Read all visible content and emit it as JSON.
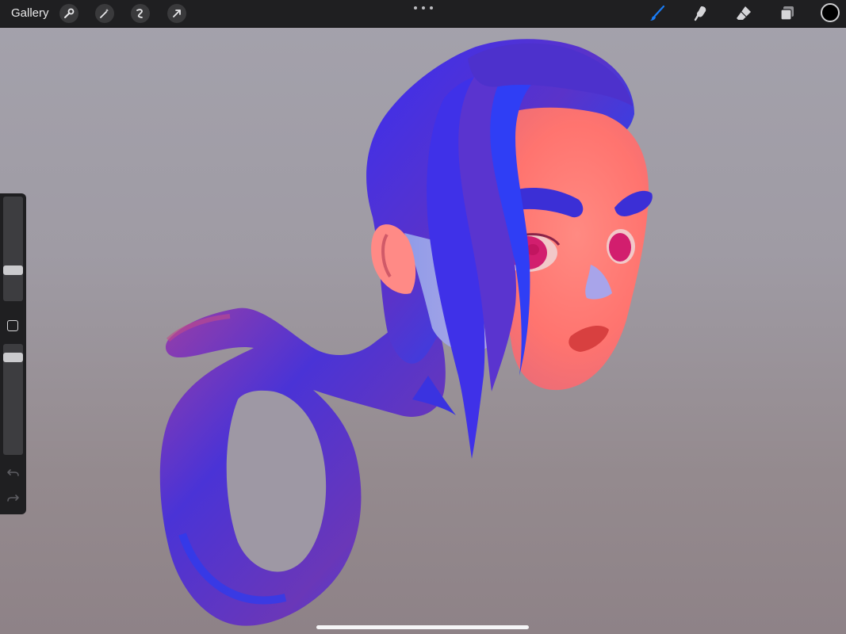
{
  "toolbar": {
    "gallery_label": "Gallery",
    "left_tools": [
      "wrench-icon",
      "magic-wand-icon",
      "selection-icon",
      "transform-arrow-icon"
    ],
    "right_tools": [
      "brush-icon",
      "smudge-icon",
      "eraser-icon",
      "layers-icon"
    ],
    "active_tool": "brush-icon",
    "accent_color": "#1a7cf5",
    "current_color": "#000000"
  },
  "sidebar": {
    "brush_size_slider": "size",
    "opacity_slider": "opacity",
    "modify_button": "square-icon",
    "undo": "undo-icon",
    "redo": "redo-icon"
  },
  "canvas": {
    "background_top": "#a4a2ac",
    "background_bottom": "#8e8287",
    "skin_color": "#ff7a78",
    "hair_color": "#3b2fe0",
    "eye_color": "#d21e6e"
  }
}
